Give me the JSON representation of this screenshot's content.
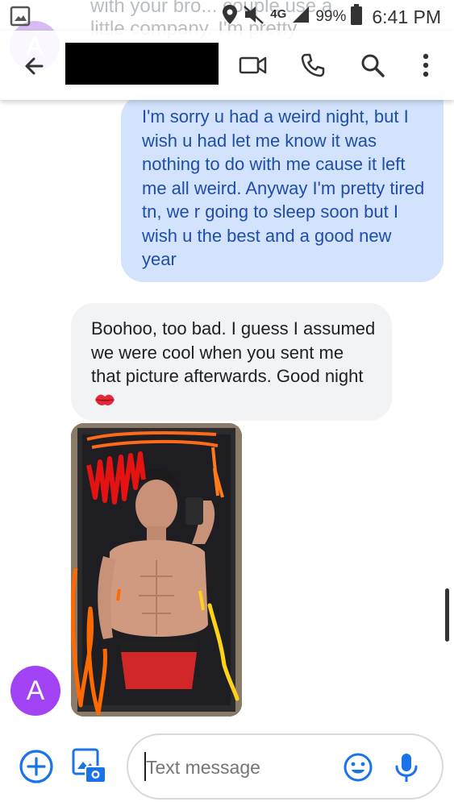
{
  "status_bar": {
    "network": "4G",
    "battery": "99%",
    "time": "6:41 PM"
  },
  "previous_message": {
    "text": "with your bro... couple use a little company. I'm pretty",
    "avatar_letter": "A"
  },
  "header": {
    "contact_name": "",
    "icons": [
      "back-arrow-icon",
      "video-call-icon",
      "phone-icon",
      "search-icon",
      "more-vert-icon"
    ]
  },
  "messages": [
    {
      "direction": "outgoing",
      "text": "I'm sorry u had a weird night, but I wish u had let me know it was nothing to do with me cause it left me all weird. Anyway I'm pretty tired tn, we r going to sleep soon but I wish u the best and a good new year"
    },
    {
      "direction": "incoming",
      "text": "Boohoo, too bad. I guess I assumed we were cool when you sent me that picture afterwards. Good night",
      "emoji": "kiss-mark-icon"
    },
    {
      "direction": "incoming",
      "type": "image",
      "avatar_letter": "A"
    }
  ],
  "compose": {
    "placeholder": "Text message",
    "icons": [
      "add-icon",
      "gallery-camera-icon",
      "emoji-icon",
      "mic-icon"
    ]
  },
  "colors": {
    "accent": "#1a73e8",
    "outgoing_bubble": "#d3e3fd",
    "outgoing_text": "#1f4ea8",
    "incoming_bubble": "#f1f3f4",
    "avatar": "#a142f4"
  }
}
